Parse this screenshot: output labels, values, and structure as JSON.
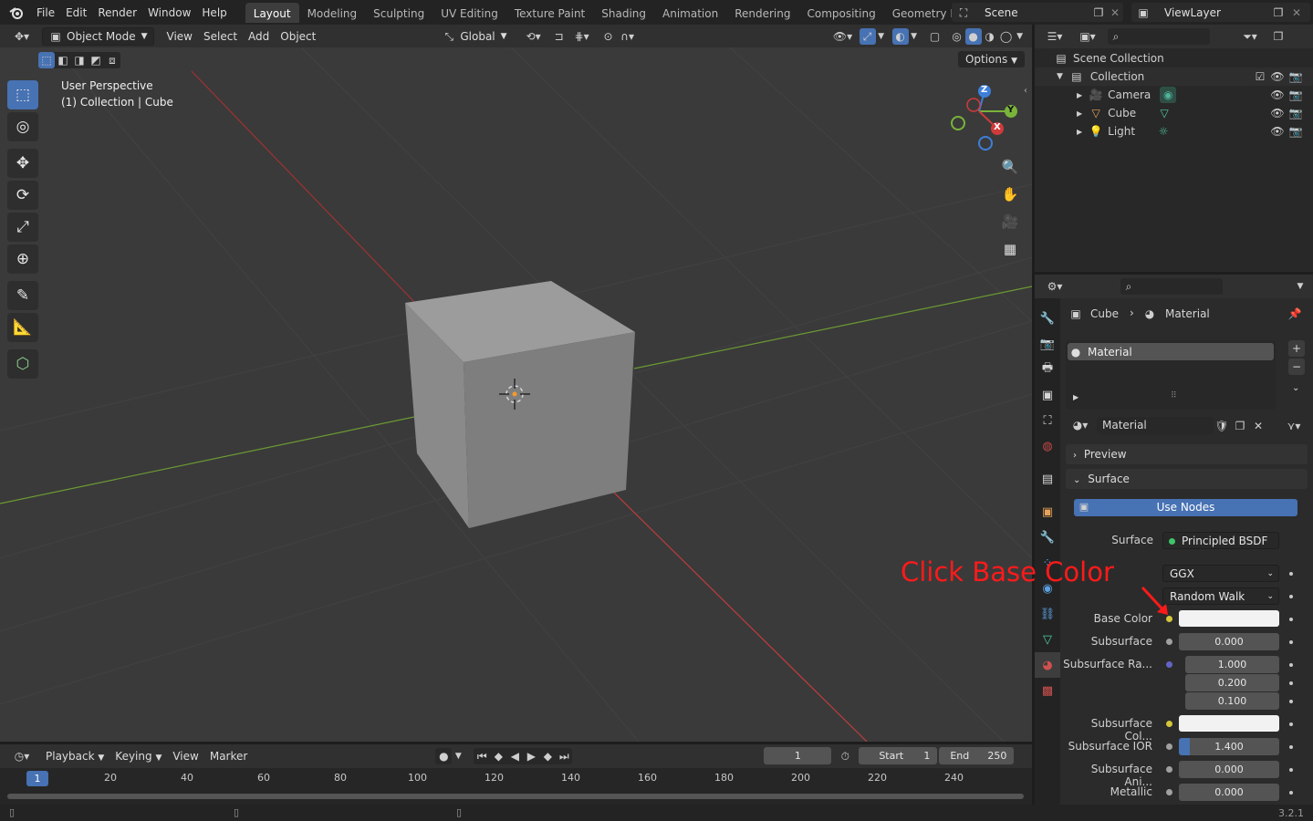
{
  "topbar": {
    "menus": [
      "File",
      "Edit",
      "Render",
      "Window",
      "Help"
    ],
    "workspaces": [
      "Layout",
      "Modeling",
      "Sculpting",
      "UV Editing",
      "Texture Paint",
      "Shading",
      "Animation",
      "Rendering",
      "Compositing",
      "Geometry Nodes"
    ],
    "active_workspace": "Layout",
    "scene": "Scene",
    "view_layer": "ViewLayer"
  },
  "viewport_header": {
    "mode": "Object Mode",
    "menus": [
      "View",
      "Select",
      "Add",
      "Object"
    ],
    "orientation": "Global",
    "options": "Options"
  },
  "viewport": {
    "perspective": "User Perspective",
    "context": "(1) Collection | Cube",
    "gizmo_axes": [
      "Z",
      "Y",
      "X"
    ]
  },
  "timeline": {
    "menus": [
      "Playback",
      "Keying",
      "View",
      "Marker"
    ],
    "current_frame": "1",
    "start_label": "Start",
    "start_value": "1",
    "end_label": "End",
    "end_value": "250",
    "marker": "1",
    "ticks": [
      "20",
      "40",
      "60",
      "80",
      "100",
      "120",
      "140",
      "160",
      "180",
      "200",
      "220",
      "240"
    ]
  },
  "statusbar": {
    "version": "3.2.1"
  },
  "outliner": {
    "root": "Scene Collection",
    "collection": "Collection",
    "items": [
      "Camera",
      "Cube",
      "Light"
    ]
  },
  "properties": {
    "breadcrumb_object": "Cube",
    "breadcrumb_material": "Material",
    "slot_name": "Material",
    "material_name": "Material",
    "preview_panel": "Preview",
    "surface_panel": "Surface",
    "use_nodes": "Use Nodes",
    "surface_label": "Surface",
    "surface_shader": "Principled BSDF",
    "distribution": "GGX",
    "subsurface_method": "Random Walk",
    "rows": [
      {
        "label": "Base Color",
        "value": ""
      },
      {
        "label": "Subsurface",
        "value": "0.000"
      },
      {
        "label": "Subsurface Ra...",
        "value": "1.000"
      },
      {
        "label": "",
        "value": "0.200"
      },
      {
        "label": "",
        "value": "0.100"
      },
      {
        "label": "Subsurface Col...",
        "value": ""
      },
      {
        "label": "Subsurface IOR",
        "value": "1.400"
      },
      {
        "label": "Subsurface Ani...",
        "value": "0.000"
      },
      {
        "label": "Metallic",
        "value": "0.000"
      }
    ]
  },
  "annotation": {
    "text": "Click Base Color",
    "color": "#ff1a1a"
  },
  "colors": {
    "accent": "#4772b3",
    "x_axis": "#d03a3a",
    "y_axis": "#7ab33a",
    "z_axis": "#3d7fd9"
  }
}
